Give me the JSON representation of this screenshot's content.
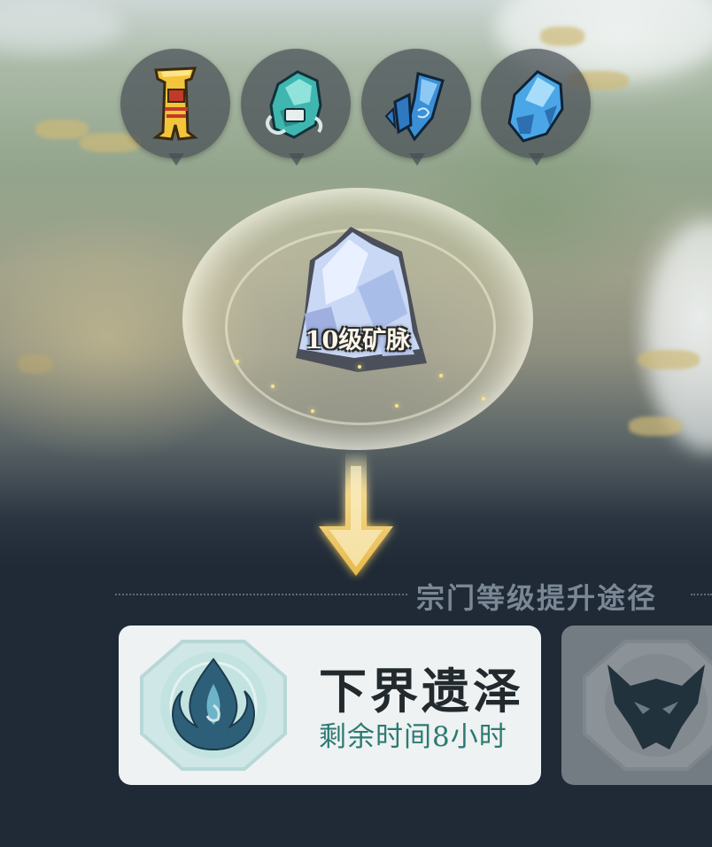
{
  "resource_bubbles": [
    {
      "name": "token",
      "icon": "yellow-token-icon",
      "color": "#f2c53a"
    },
    {
      "name": "jade-ore",
      "icon": "teal-ore-icon",
      "color": "#3fb7b0"
    },
    {
      "name": "crystal-shards",
      "icon": "blue-crystal-shards-icon",
      "color": "#3a8fd6"
    },
    {
      "name": "blue-stone",
      "icon": "blue-stone-icon",
      "color": "#4aa6e6"
    }
  ],
  "mine": {
    "label": "10级矿脉",
    "icon": "crystal-vein-icon"
  },
  "section": {
    "title": "宗门等级提升途径"
  },
  "cards": [
    {
      "title": "下界遗泽",
      "subtitle": "剩余时间8小时",
      "icon": "blue-flame-emblem-icon",
      "accent": "#2c7a73"
    },
    {
      "icon": "demon-mask-emblem-icon"
    }
  ],
  "colors": {
    "background": "#1f2a36",
    "card_bg": "#eef2f2",
    "title_text": "#232a2e",
    "section_title": "#7a8794"
  }
}
